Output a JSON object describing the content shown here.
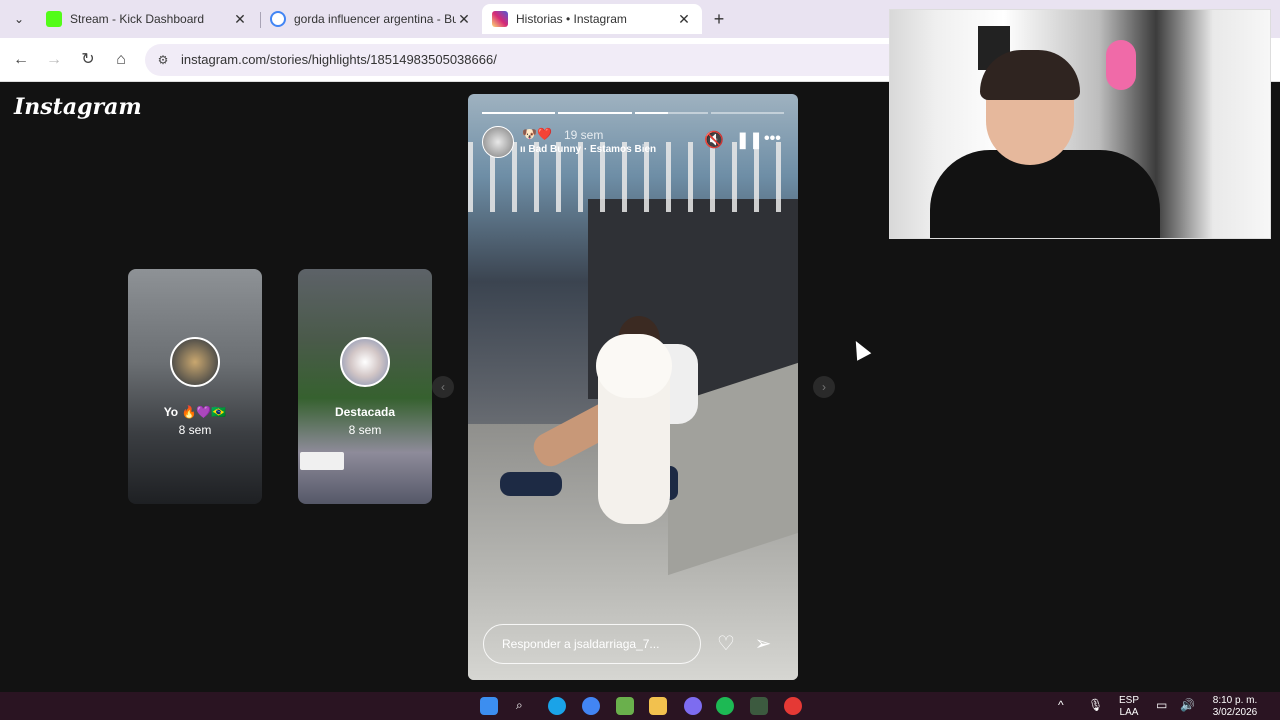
{
  "browser": {
    "tabs": [
      {
        "title": "Stream - Kick Dashboard",
        "favicon_color": "#53fc18"
      },
      {
        "title": "gorda influencer argentina - Bu",
        "favicon_color": "#4285f4"
      },
      {
        "title": "Historias • Instagram",
        "favicon_color": "#e1306c"
      }
    ],
    "new_tab": "+",
    "url": "instagram.com/stories/highlights/18514983505038666/"
  },
  "instagram": {
    "logo": "Instagram",
    "highlights": [
      {
        "name": "Yo 🔥💜🇧🇷",
        "time": "8 sem"
      },
      {
        "name": "Destacada",
        "time": "8 sem"
      }
    ],
    "story": {
      "emojis": "🐶❤️",
      "time": "19 sem",
      "music": "Bad Bunny · Estamos Bien",
      "reply_placeholder": "Responder a jsaldarriaga_7..."
    }
  },
  "taskbar": {
    "lang_top": "ESP",
    "lang_bottom": "LAA",
    "time": "8:10 p. m.",
    "date": "3/02/2026"
  },
  "colors": {
    "page_bg": "#121212",
    "tab_strip": "#e9e3f1",
    "taskbar_bg": "#2a1422"
  }
}
